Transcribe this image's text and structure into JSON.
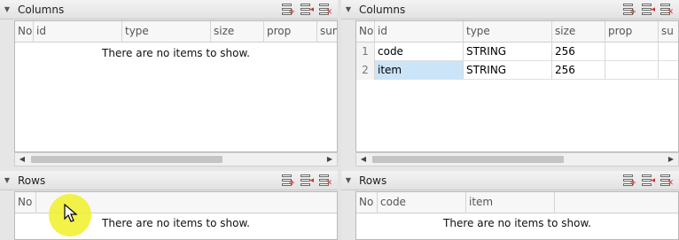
{
  "left_pane": {
    "columns_section": {
      "title": "Columns",
      "headers": [
        "No",
        "id",
        "type",
        "size",
        "prop",
        "sun"
      ],
      "empty_message": "There are no items to show."
    },
    "rows_section": {
      "title": "Rows",
      "headers": [
        "No",
        ""
      ],
      "empty_message": "There are no items to show."
    }
  },
  "right_pane": {
    "columns_section": {
      "title": "Columns",
      "headers": [
        "No",
        "id",
        "type",
        "size",
        "prop",
        "su"
      ],
      "rows": [
        {
          "no": "1",
          "id": "code",
          "type": "STRING",
          "size": "256",
          "prop": "",
          "su": ""
        },
        {
          "no": "2",
          "id": "item",
          "type": "STRING",
          "size": "256",
          "prop": "",
          "su": ""
        }
      ]
    },
    "rows_section": {
      "title": "Rows",
      "headers": [
        "No",
        "code",
        "item"
      ],
      "empty_message": "There are no items to show."
    }
  },
  "icons": {
    "collapse": "triangle-down-icon",
    "add_row": "add-row-icon",
    "insert_row": "insert-row-icon",
    "delete_row": "delete-row-icon",
    "scroll_left": "scroll-left-arrow-icon",
    "scroll_right": "scroll-right-arrow-icon"
  }
}
